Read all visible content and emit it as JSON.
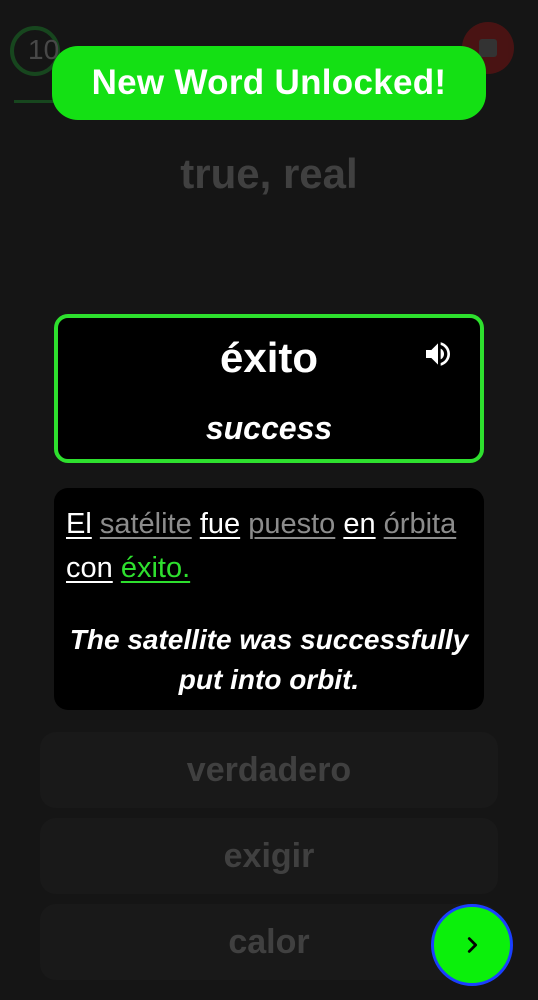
{
  "background": {
    "score_text": "10",
    "question": "true, real",
    "options": [
      "verdadero",
      "exigir",
      "calor"
    ]
  },
  "banner": {
    "text": "New Word Unlocked!"
  },
  "word_card": {
    "spanish": "éxito",
    "english": "success",
    "icon": "speaker-icon"
  },
  "sentence": {
    "words": [
      {
        "text": "El",
        "color": "white"
      },
      {
        "text": "satélite",
        "color": "gray"
      },
      {
        "text": "fue",
        "color": "white"
      },
      {
        "text": "puesto",
        "color": "gray"
      },
      {
        "text": "en",
        "color": "white"
      },
      {
        "text": "órbita",
        "color": "gray"
      },
      {
        "text": "con",
        "color": "white"
      },
      {
        "text": "éxito.",
        "color": "green"
      }
    ],
    "translation": "The satellite was successfully put into orbit."
  },
  "next_button": {
    "icon": "chevron-right-icon"
  },
  "colors": {
    "accent": "#14e014",
    "card_border": "#2ee02e",
    "gray_word": "#8c8c8c",
    "close": "#dd1111"
  }
}
